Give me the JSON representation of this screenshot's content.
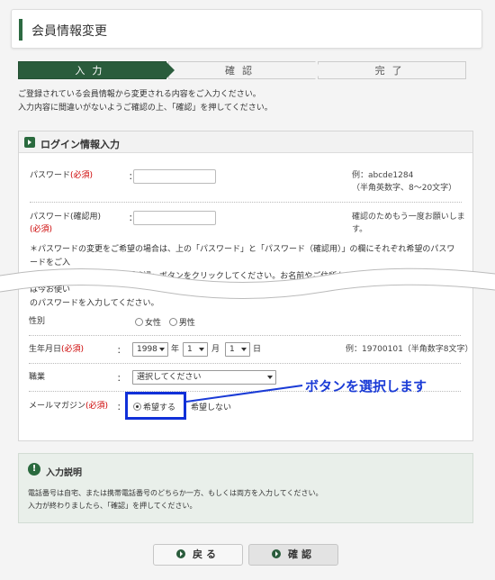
{
  "header": {
    "title": "会員情報変更"
  },
  "steps": [
    {
      "label": "入力"
    },
    {
      "label": "確認"
    },
    {
      "label": "完了"
    }
  ],
  "intro": {
    "line1": "ご登録されている会員情報から変更される内容をご入力ください。",
    "line2": "入力内容に間違いがないようご確認の上、「確認」を押してください。"
  },
  "login_section": {
    "title": "ログイン情報入力",
    "password_label": "パスワード",
    "required": "(必須)",
    "colon": "：",
    "password_note1": "例：abcde1284",
    "password_note2": "（半角英数字、8～20文字）",
    "password_confirm_label": "パスワード(確認用)",
    "password_confirm_note1": "確認のためもう一度お願いしま",
    "password_confirm_note2": "す。",
    "pw_note_line1": "＊パスワードの変更をご希望の場合は、上の「パスワード」と「パスワード（確認用）」の欄にそれぞれ希望のパスワードをご入",
    "pw_note_line2": "力のうえ、ページ下にある「確認」ボタンをクリックしてください。お名前やご住所などのお客様情報の変更の場合には今お使い",
    "pw_note_line3": "のパスワードを入力してください。"
  },
  "profile": {
    "gender_label": "性別",
    "gender_female": "女性",
    "gender_male": "男性",
    "birth_label": "生年月日",
    "birth_year": "1998",
    "birth_year_unit": "年",
    "birth_month": "1",
    "birth_month_unit": "月",
    "birth_day": "1",
    "birth_day_unit": "日",
    "birth_note": "例：19700101（半角数字8文字）",
    "job_label": "職業",
    "job_value": "選択してください",
    "mail_label": "メールマガジン",
    "mail_yes": "希望する",
    "mail_no": "希望しない"
  },
  "annotation": {
    "text": "ボタンを選択します"
  },
  "help": {
    "title": "入力説明",
    "line1": "電話番号は自宅、または携帯電話番号のどちらか一方、もしくは両方を入力してください。",
    "line2": "入力が終わりましたら、「確認」を押してください。"
  },
  "buttons": {
    "back": "戻る",
    "confirm": "確認"
  },
  "colors": {
    "brand_green": "#2a5c3c",
    "required_red": "#cc0000",
    "annotation_blue": "#1a3bd6"
  }
}
